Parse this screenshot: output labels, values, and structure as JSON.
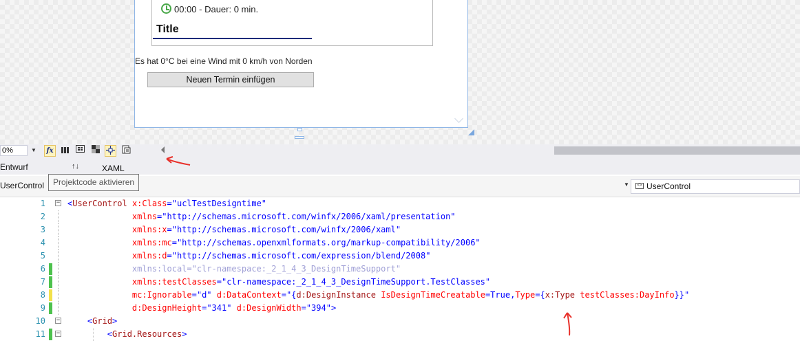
{
  "designer": {
    "time_text": "00:00 - Dauer: 0 min.",
    "title_text": "Title",
    "weather_text": "Es hat 0°C bei eine Wind mit 0 km/h von Norden",
    "add_button_label": "Neuen Termin einfügen"
  },
  "toolbar": {
    "zoom_value": "0%",
    "fx_label": "fx",
    "icons": [
      "dropdown-arrow-icon",
      "fx-icon",
      "grid-icon",
      "snap-grid-icon",
      "artboard-icon",
      "snap-lines-icon",
      "project-code-icon",
      "scroll-left-icon"
    ]
  },
  "view_tabs": {
    "design": "Entwurf",
    "swap": "↑↓",
    "xaml": "XAML"
  },
  "tooltip": "Projektcode aktivieren",
  "nav": {
    "left_value": "UserControl",
    "right_value": "UserControl"
  },
  "code_lines": [
    {
      "n": "1",
      "change": "",
      "segments": [
        [
          "br",
          "<"
        ],
        [
          "el",
          "UserControl"
        ],
        [
          "at",
          " x:Class"
        ],
        [
          "br",
          "="
        ],
        [
          "vl",
          "\"uclTestDesigntime\""
        ]
      ]
    },
    {
      "n": "2",
      "change": "",
      "segments": [
        [
          "pad",
          "             "
        ],
        [
          "at",
          "xmlns"
        ],
        [
          "br",
          "="
        ],
        [
          "vl",
          "\"http://schemas.microsoft.com/winfx/2006/xaml/presentation\""
        ]
      ]
    },
    {
      "n": "3",
      "change": "",
      "segments": [
        [
          "pad",
          "             "
        ],
        [
          "at",
          "xmlns:x"
        ],
        [
          "br",
          "="
        ],
        [
          "vl",
          "\"http://schemas.microsoft.com/winfx/2006/xaml\""
        ]
      ]
    },
    {
      "n": "4",
      "change": "",
      "segments": [
        [
          "pad",
          "             "
        ],
        [
          "at",
          "xmlns:mc"
        ],
        [
          "br",
          "="
        ],
        [
          "vl",
          "\"http://schemas.openxmlformats.org/markup-compatibility/2006\""
        ]
      ]
    },
    {
      "n": "5",
      "change": "",
      "segments": [
        [
          "pad",
          "             "
        ],
        [
          "at",
          "xmlns:d"
        ],
        [
          "br",
          "="
        ],
        [
          "vl",
          "\"http://schemas.microsoft.com/expression/blend/2008\""
        ]
      ]
    },
    {
      "n": "6",
      "change": "#4ec24e",
      "segments": [
        [
          "pad",
          "             "
        ],
        [
          "gr",
          "xmlns:local=\"clr-namespace:_2_1_4_3_DesignTimeSupport\""
        ]
      ]
    },
    {
      "n": "7",
      "change": "#4ec24e",
      "segments": [
        [
          "pad",
          "             "
        ],
        [
          "at",
          "xmlns:testClasses"
        ],
        [
          "br",
          "="
        ],
        [
          "vl",
          "\"clr-namespace:_2_1_4_3_DesignTimeSupport.TestClasses\""
        ]
      ]
    },
    {
      "n": "8",
      "change": "#f2e14b",
      "segments": [
        [
          "pad",
          "             "
        ],
        [
          "at",
          "mc:Ignorable"
        ],
        [
          "br",
          "="
        ],
        [
          "vl",
          "\"d\""
        ],
        [
          "at",
          " d:DataContext"
        ],
        [
          "br",
          "="
        ],
        [
          "vl",
          "\"{"
        ],
        [
          "el",
          "d:DesignInstance"
        ],
        [
          "at",
          " IsDesignTimeCreatable"
        ],
        [
          "br",
          "="
        ],
        [
          "vl",
          "True"
        ],
        [
          "br",
          ","
        ],
        [
          "at",
          "Type"
        ],
        [
          "br",
          "="
        ],
        [
          "vl",
          "{"
        ],
        [
          "el",
          "x:Type"
        ],
        [
          "at",
          " testClasses:DayInfo"
        ],
        [
          "vl",
          "}}\""
        ]
      ]
    },
    {
      "n": "9",
      "change": "#4ec24e",
      "segments": [
        [
          "pad",
          "             "
        ],
        [
          "at",
          "d:DesignHeight"
        ],
        [
          "br",
          "="
        ],
        [
          "vl",
          "\"341\""
        ],
        [
          "at",
          " d:DesignWidth"
        ],
        [
          "br",
          "="
        ],
        [
          "vl",
          "\"394\""
        ],
        [
          "br",
          ">"
        ]
      ]
    },
    {
      "n": "10",
      "change": "",
      "segments": [
        [
          "pad",
          "    "
        ],
        [
          "br",
          "<"
        ],
        [
          "el",
          "Grid"
        ],
        [
          "br",
          ">"
        ]
      ]
    },
    {
      "n": "11",
      "change": "#4ec24e",
      "segments": [
        [
          "pad",
          "        "
        ],
        [
          "br",
          "<"
        ],
        [
          "el",
          "Grid.Resources"
        ],
        [
          "br",
          ">"
        ]
      ]
    }
  ]
}
